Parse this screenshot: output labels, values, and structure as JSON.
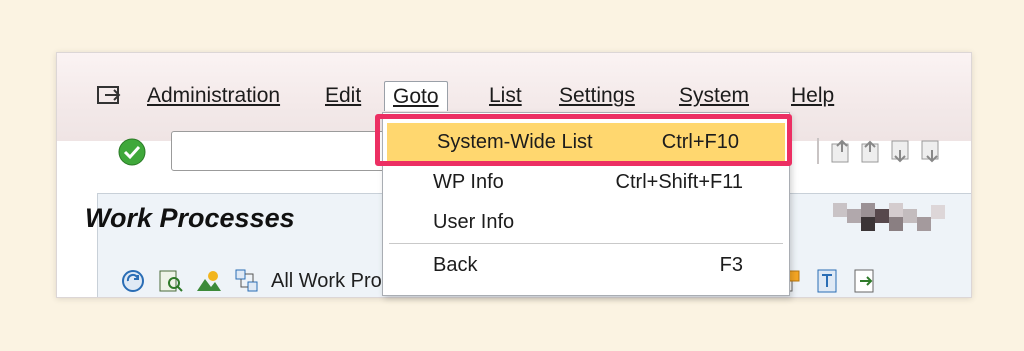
{
  "menubar": {
    "items": [
      {
        "label": "Administration"
      },
      {
        "label": "Edit"
      },
      {
        "label": "Goto"
      },
      {
        "label": "List"
      },
      {
        "label": "Settings"
      },
      {
        "label": "System"
      },
      {
        "label": "Help"
      }
    ]
  },
  "toolbar": {
    "command_value": ""
  },
  "panel": {
    "title": "Work Processes",
    "all_work_processes_label": "All Work Processes"
  },
  "goto_menu": {
    "items": [
      {
        "label": "System-Wide List",
        "shortcut": "Ctrl+F10"
      },
      {
        "label": "WP Info",
        "shortcut": "Ctrl+Shift+F11"
      },
      {
        "label": "User Info",
        "shortcut": ""
      },
      {
        "label": "Back",
        "shortcut": "F3"
      }
    ]
  },
  "colors": {
    "highlight_border": "#ec2f63",
    "menu_highlight": "#ffd76f",
    "background": "#fbf3e2"
  }
}
